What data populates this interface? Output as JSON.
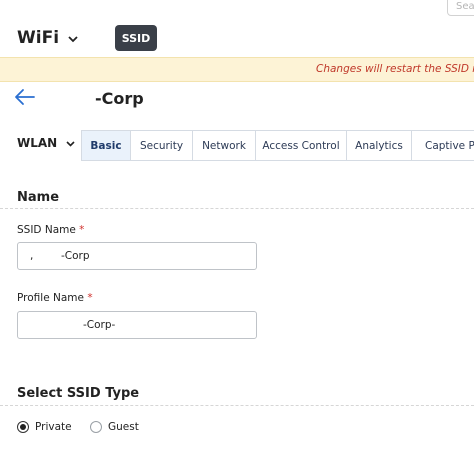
{
  "search": {
    "placeholder_partial": "Sea"
  },
  "header": {
    "title": "WiFi",
    "badge": "SSID"
  },
  "warning": {
    "text": "Changes will restart the SSID if it i..."
  },
  "page": {
    "title": "-Corp"
  },
  "wlan_select": {
    "label": "WLAN"
  },
  "tabs": [
    {
      "label": "Basic",
      "active": true
    },
    {
      "label": "Security",
      "active": false
    },
    {
      "label": "Network",
      "active": false
    },
    {
      "label": "Access Control",
      "active": false
    },
    {
      "label": "Analytics",
      "active": false
    },
    {
      "label": "Captive Por",
      "active": false
    }
  ],
  "name_section": {
    "title": "Name",
    "ssid_name": {
      "label": "SSID Name",
      "required_mark": "*",
      "value_prefix": ",",
      "value": "-Corp"
    },
    "profile_name": {
      "label": "Profile Name",
      "required_mark": "*",
      "value": "-Corp-"
    }
  },
  "ssid_type": {
    "title": "Select SSID Type",
    "options": [
      {
        "label": "Private",
        "checked": true
      },
      {
        "label": "Guest",
        "checked": false
      }
    ]
  },
  "colors": {
    "badge_bg": "#3a3f48",
    "warning_bg": "#fdf3d6",
    "warning_text": "#c0392b",
    "accent": "#2a6fd1",
    "active_tab_bg": "#eaf2fb",
    "required": "#d0312d"
  }
}
